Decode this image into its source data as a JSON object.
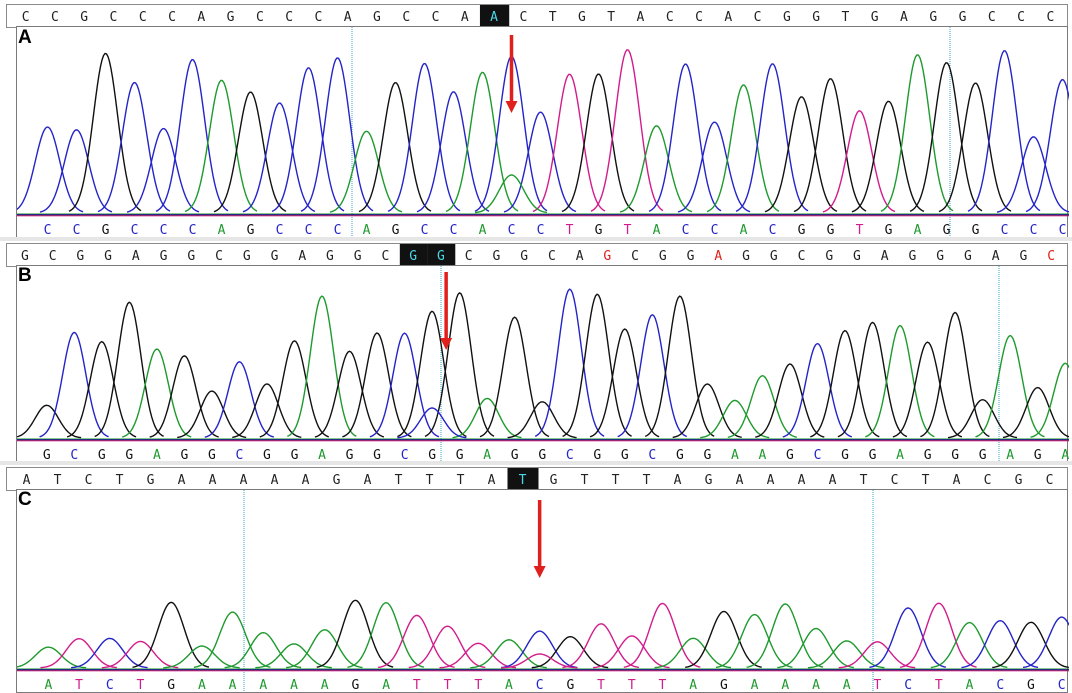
{
  "panels": [
    {
      "label": "A",
      "top_seq": "CCGCCCAGCCCAGCCAACTGTACCACGGTGAGGCCC",
      "highlight": [
        16
      ],
      "bottom_seq": "CCGCCCAGCCCAGCCACCTGTACCACGGTGAGGCCC",
      "arrow_index": 16
    },
    {
      "label": "B",
      "top_seq": "GCGGAGGCGGAGGCGGCGGCAGCGGAGGCGGAGGGAGC",
      "highlight": [
        14,
        15
      ],
      "top_red": [
        21,
        25,
        37
      ],
      "bottom_seq": "GCGGAGGCGGAGGCGGAGGCGGCGGAAGCGGAGGGAGA",
      "arrow_index": 14
    },
    {
      "label": "C",
      "top_seq": "ATCTGAAAAAGATTTATGTTTAGAAAATCTACGC",
      "highlight": [
        16
      ],
      "bottom_seq": "ATCTGAAAAAGATTTACGTTTAGAAAATCTACGC",
      "arrow_index": 16
    }
  ],
  "colors": {
    "A": "#1e9a2e",
    "C": "#2424c8",
    "G": "#111111",
    "T": "#d21c8c",
    "arrow": "#e0201c",
    "highlight_bg": "#111111",
    "highlight_fg": "#49d6e6",
    "marker_line": "#3aa0c8"
  }
}
